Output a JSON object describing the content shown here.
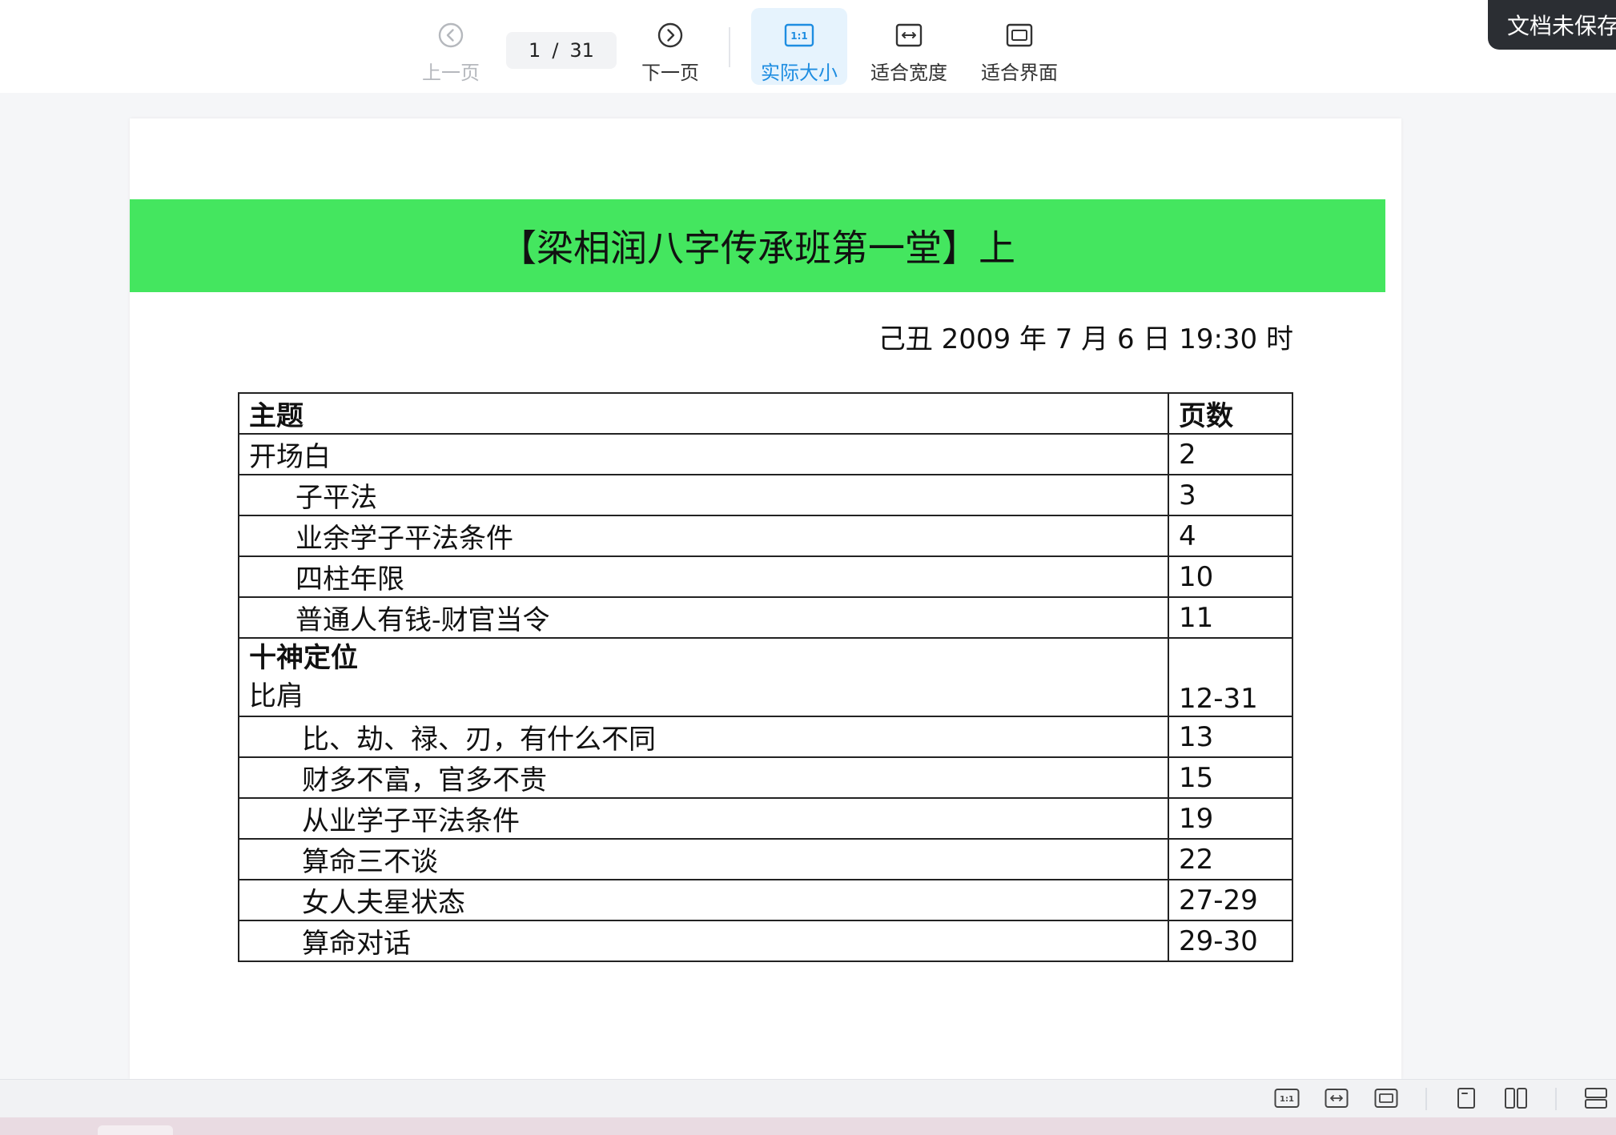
{
  "toolbar": {
    "prev_label": "上一页",
    "next_label": "下一页",
    "actual_size_label": "实际大小",
    "fit_width_label": "适合宽度",
    "fit_page_label": "适合界面",
    "current_page": "1",
    "page_separator": "/",
    "total_pages": "31",
    "actual_size_icon_text": "1:1"
  },
  "status": {
    "unsaved_label": "文档未保存"
  },
  "document": {
    "banner_title": "【梁相润八字传承班第一堂】上",
    "banner_color": "#44e65f",
    "date_line": "己丑 2009 年 7 月 6 日 19:30 时",
    "table": {
      "header": {
        "topic": "主题",
        "pages": "页数"
      },
      "rows": [
        {
          "topic": "开场白",
          "pages": "2"
        },
        {
          "topic": "子平法",
          "pages": "3"
        },
        {
          "topic": "业余学子平法条件",
          "pages": "4"
        },
        {
          "topic": "四柱年限",
          "pages": "10"
        },
        {
          "topic": "普通人有钱-财官当令",
          "pages": "11"
        },
        {
          "topic_bold": "十神定位",
          "topic": "比肩",
          "pages": "12-31"
        },
        {
          "topic": "比、劫、禄、刃，有什么不同",
          "pages": "13"
        },
        {
          "topic": "财多不富，官多不贵",
          "pages": "15"
        },
        {
          "topic": "从业学子平法条件",
          "pages": "19"
        },
        {
          "topic": "算命三不谈",
          "pages": "22"
        },
        {
          "topic": "女人夫星状态",
          "pages": "27-29"
        },
        {
          "topic": "算命对话",
          "pages": "29-30"
        }
      ]
    }
  },
  "bottombar": {
    "actual_size_icon_text": "1:1"
  },
  "colors": {
    "accent": "#1e8de1",
    "active_bg": "#e6f3fd",
    "disabled": "#b5b8bd"
  }
}
